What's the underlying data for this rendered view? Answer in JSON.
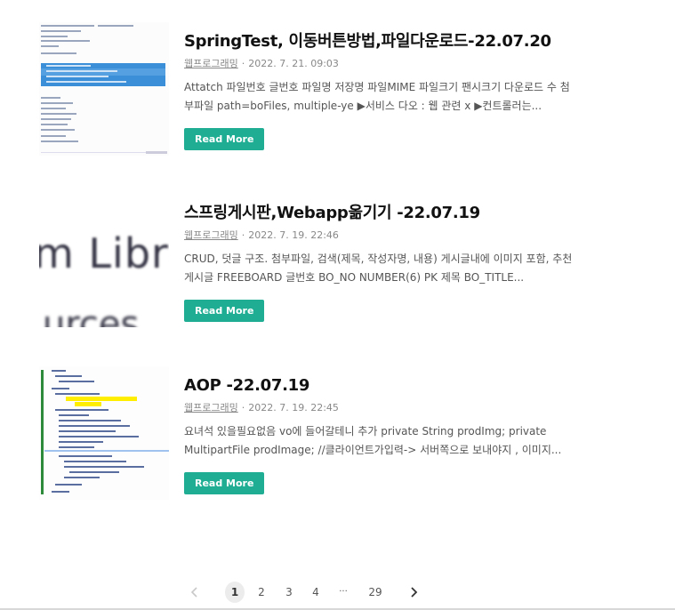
{
  "posts": [
    {
      "title": "SpringTest, 이동버튼방법,파일다운로드-22.07.20",
      "author": "웹프로그래밍",
      "date": "2022. 7. 21. 09:03",
      "excerpt": "Attatch 파일번호 글번호 파일명 저장명 파일MIME 파일크기 팬시크기 다운로드 수 첨부파일 path=boFiles, multiple-ye ▶서비스 다오 : 웹 관련 x ▶컨트롤러는...",
      "read_more": "Read More"
    },
    {
      "title": "스프링게시판,Webapp옮기기 -22.07.19",
      "author": "웹프로그래밍",
      "date": "2022. 7. 19. 22:46",
      "excerpt": "CRUD, 덧글 구조. 첨부파일, 검색(제목, 작성자명, 내용) 게시글내에 이미지 포함, 추천 게시글 FREEBOARD 글번호 BO_NO NUMBER(6) PK 제목 BO_TITLE...",
      "read_more": "Read More",
      "thumb_text_1": "m Libra",
      "thumb_text_2": "urces"
    },
    {
      "title": "AOP -22.07.19",
      "author": "웹프로그래밍",
      "date": "2022. 7. 19. 22:45",
      "excerpt": "요녀석 있을필요없음 vo에 들어갈테니 추가 private String prodImg; private MultipartFile prodImage; //클라이언트가입력-> 서버쪽으로 보내야지 , 이미지...",
      "read_more": "Read More"
    }
  ],
  "pagination": {
    "prev_icon": "chevron-left-icon",
    "next_icon": "chevron-right-icon",
    "pages": [
      "1",
      "2",
      "3",
      "4"
    ],
    "ellipsis": "···",
    "last": "29",
    "active": "1"
  },
  "colors": {
    "accent": "#1fae94",
    "title": "#111111",
    "meta": "#888888",
    "code_highlight": "#3b8fd8",
    "marker_yellow": "#ffee00"
  }
}
